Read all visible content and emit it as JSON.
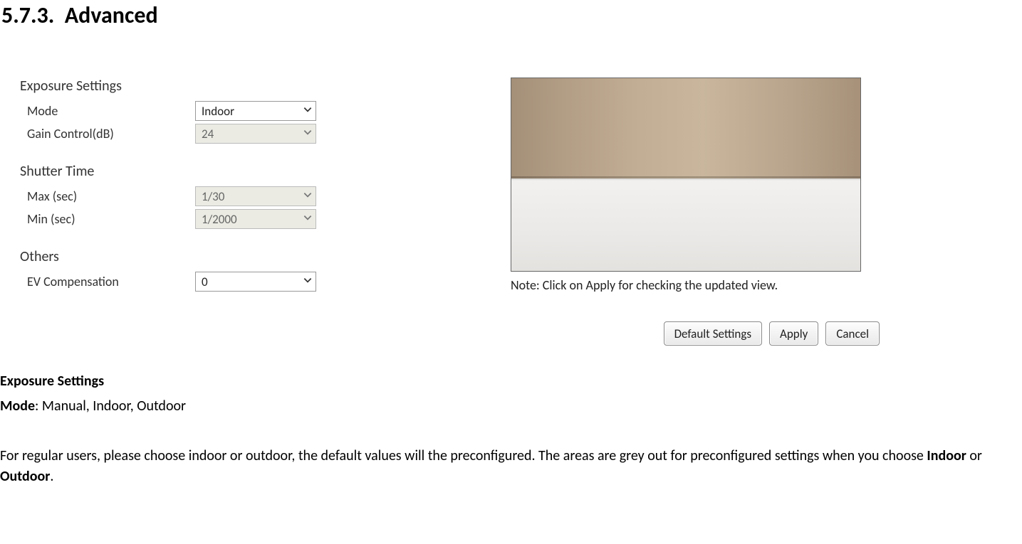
{
  "heading_number": "5.7.3.",
  "heading_text": "Advanced",
  "exposure": {
    "title": "Exposure Settings",
    "mode_label": "Mode",
    "mode_value": "Indoor",
    "gain_label": "Gain Control(dB)",
    "gain_value": "24"
  },
  "shutter": {
    "title": "Shutter Time",
    "max_label": "Max (sec)",
    "max_value": "1/30",
    "min_label": "Min (sec)",
    "min_value": "1/2000"
  },
  "others": {
    "title": "Others",
    "ev_label": "EV Compensation",
    "ev_value": "0"
  },
  "preview_note": "Note: Click on Apply for checking the updated view.",
  "buttons": {
    "default": "Default Settings",
    "apply": "Apply",
    "cancel": "Cancel"
  },
  "body": {
    "l1a": "Exposure Settings",
    "l2a": "Mode",
    "l2b": ": Manual, Indoor, Outdoor",
    "l3a": "For regular users, please choose indoor or outdoor, the default values will the preconfigured. The areas are grey out for preconfigured settings when you choose ",
    "l3b": "Indoor",
    "l3c": " or ",
    "l3d": "Outdoor",
    "l3e": "."
  }
}
